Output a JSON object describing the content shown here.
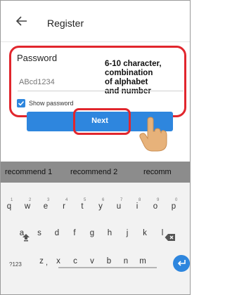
{
  "header": {
    "title": "Register"
  },
  "form": {
    "password_label": "Password",
    "password_value": "ABcd1234",
    "show_password_label": "Show password",
    "show_password_checked": true,
    "hint_lines": [
      "6-10 character,",
      "combination",
      "of alphabet",
      "and number"
    ]
  },
  "next_button": {
    "label": "Next"
  },
  "keyboard": {
    "suggestions": [
      "recommend 1",
      "recommend 2",
      "recomm"
    ],
    "row1": [
      "q",
      "w",
      "e",
      "r",
      "t",
      "y",
      "u",
      "i",
      "o",
      "p"
    ],
    "row1_numbers": [
      "1",
      "2",
      "3",
      "4",
      "5",
      "6",
      "7",
      "8",
      "9",
      "0"
    ],
    "row2": [
      "a",
      "s",
      "d",
      "f",
      "g",
      "h",
      "j",
      "k",
      "l"
    ],
    "row3": [
      "z",
      "x",
      "c",
      "v",
      "b",
      "n",
      "m"
    ],
    "symbols_key": "?123",
    "comma_key": ","
  },
  "colors": {
    "accent": "#2e86de",
    "highlight": "#e1262d",
    "suggestion_bar": "#8c8c8c"
  },
  "icons": {
    "back": "arrow-left-icon",
    "shift": "shift-icon",
    "backspace": "backspace-icon",
    "enter": "enter-icon",
    "hand": "tap-hand-icon"
  }
}
